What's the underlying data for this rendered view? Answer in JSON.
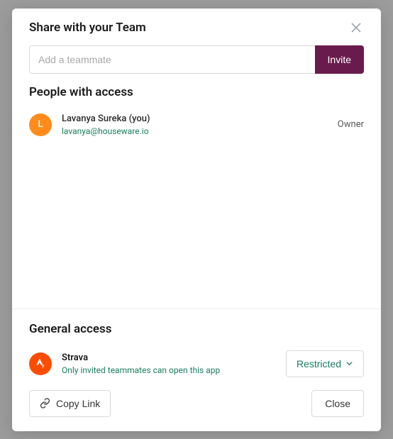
{
  "header": {
    "title": "Share with your Team"
  },
  "invite": {
    "placeholder": "Add a teammate",
    "button_label": "Invite"
  },
  "people_section": {
    "title": "People with access",
    "members": [
      {
        "avatar_initial": "L",
        "name": "Lavanya Sureka (you)",
        "email": "lavanya@houseware.io",
        "role": "Owner"
      }
    ]
  },
  "general_section": {
    "title": "General access",
    "app": {
      "name": "Strava",
      "description": "Only invited teammates can open this app",
      "access_label": "Restricted"
    }
  },
  "footer": {
    "copy_link_label": "Copy Link",
    "close_label": "Close"
  }
}
